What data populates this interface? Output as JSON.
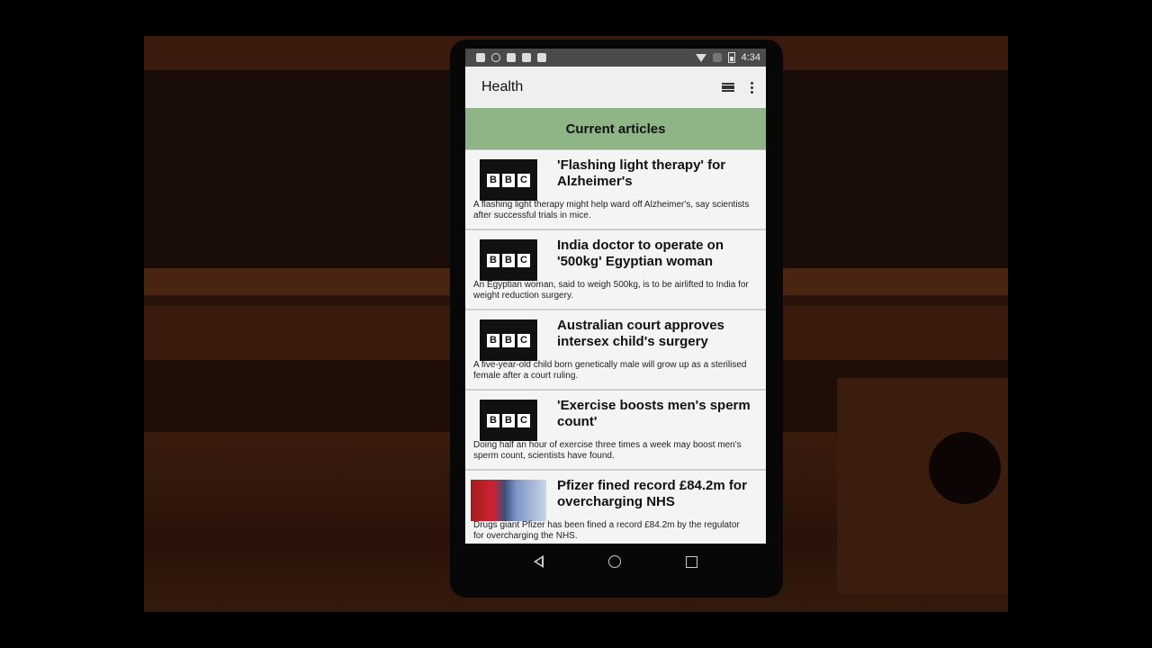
{
  "statusbar": {
    "time": "4:34"
  },
  "appbar": {
    "title": "Health"
  },
  "section": {
    "title": "Current articles"
  },
  "articles": [
    {
      "thumb": "bbc-logo",
      "title": "'Flashing light therapy' for Alzheimer's",
      "desc": "A flashing light therapy might help ward off Alzheimer's, say scientists after successful trials in mice."
    },
    {
      "thumb": "bbc-logo",
      "title": "India doctor to operate on '500kg' Egyptian woman",
      "desc": "An Egyptian woman, said to weigh 500kg, is to be airlifted to India for weight reduction surgery."
    },
    {
      "thumb": "bbc-logo",
      "title": "Australian court approves intersex child's surgery",
      "desc": "A five-year-old child born genetically male will grow up as a sterilised female after a court ruling."
    },
    {
      "thumb": "bbc-logo",
      "title": "'Exercise boosts men's sperm count'",
      "desc": "Doing half an hour of exercise three times a week may boost men's sperm count, scientists have found."
    },
    {
      "thumb": "hospital-photo",
      "title": "Pfizer fined record £84.2m for overcharging NHS",
      "desc": "Drugs giant Pfizer has been fined a record £84.2m by the regulator for overcharging the NHS."
    }
  ],
  "logo": {
    "b1": "B",
    "b2": "B",
    "c": "C"
  }
}
